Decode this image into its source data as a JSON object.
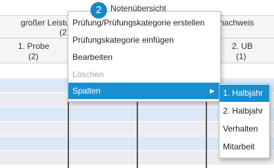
{
  "header": {
    "title": "Notenübersicht",
    "badge": "2",
    "group_left": "großer Leistu",
    "group_left_count": "(2",
    "group_right": "nachweis",
    "col1_name": "1. Probe",
    "col1_count": "(2)",
    "col2_name": "2. UB",
    "col2_count": "(1)"
  },
  "context_menu": {
    "items": [
      {
        "label": "Prüfung/Prüfungskategorie erstellen",
        "enabled": true
      },
      {
        "label": "Prüfungskategorie einfügen",
        "enabled": true
      },
      {
        "label": "Bearbeiten",
        "enabled": true
      },
      {
        "label": "Löschen",
        "enabled": false
      },
      {
        "label": "Spalten",
        "enabled": true,
        "active": true,
        "has_submenu": true
      }
    ]
  },
  "submenu": {
    "items": [
      {
        "label": "1. Halbjahr",
        "active": true
      },
      {
        "label": "2. Halbjahr"
      },
      {
        "label": "Verhalten"
      },
      {
        "label": "Mitarbeit"
      }
    ]
  },
  "colors": {
    "accent": "#1a8fd0",
    "badge": "#1a86c8",
    "row_blue": "#dce8f7",
    "row_grey": "#ececf0"
  }
}
